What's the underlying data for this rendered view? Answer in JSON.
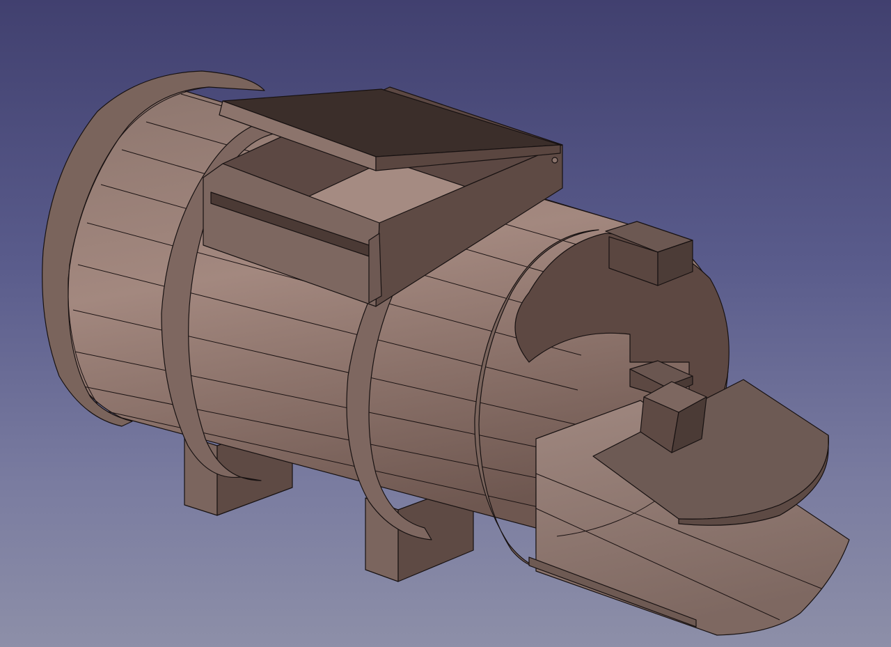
{
  "app": {
    "view": "3D view",
    "projection": "isometric",
    "background_colors": [
      "#41406f",
      "#8d8fa8"
    ]
  },
  "model": {
    "colors": {
      "base": "#8f776e",
      "light": "#a38a81",
      "mid": "#7a645c",
      "dark": "#5b4741",
      "darker": "#3e302d",
      "edge": "#171111"
    },
    "parts": [
      {
        "name": "cylinder-body"
      },
      {
        "name": "rear-flange"
      },
      {
        "name": "front-end-cap"
      },
      {
        "name": "reinforcement-ring-1"
      },
      {
        "name": "reinforcement-ring-2"
      },
      {
        "name": "top-hatch-frame"
      },
      {
        "name": "top-hatch-lid"
      },
      {
        "name": "support-leg-rear"
      },
      {
        "name": "support-leg-front"
      },
      {
        "name": "front-cutout-tray"
      },
      {
        "name": "half-disc-platform"
      },
      {
        "name": "top-right-box"
      },
      {
        "name": "small-cube-block"
      }
    ]
  }
}
